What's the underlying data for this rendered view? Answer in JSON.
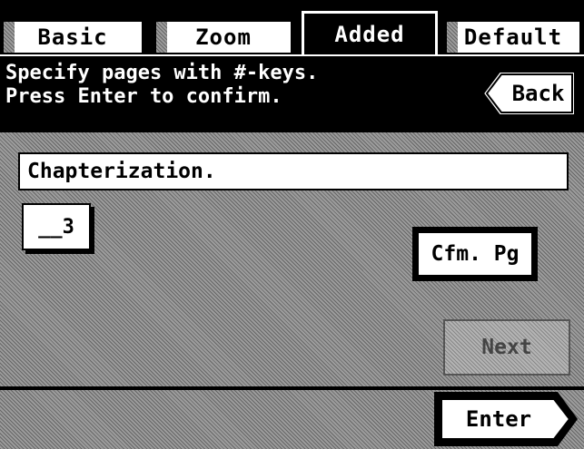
{
  "tabs": [
    {
      "label": "Basic",
      "active": false
    },
    {
      "label": "Zoom",
      "active": false
    },
    {
      "label": "Added",
      "active": true
    },
    {
      "label": "Default",
      "active": false
    }
  ],
  "message": {
    "line1": "Specify pages with #-keys.",
    "line2": "Press Enter to confirm."
  },
  "back_label": "Back",
  "name_field_value": "Chapterization.",
  "page_key_label": "__3",
  "cfm_label": "Cfm. Pg",
  "next_label": "Next",
  "enter_label": "Enter"
}
